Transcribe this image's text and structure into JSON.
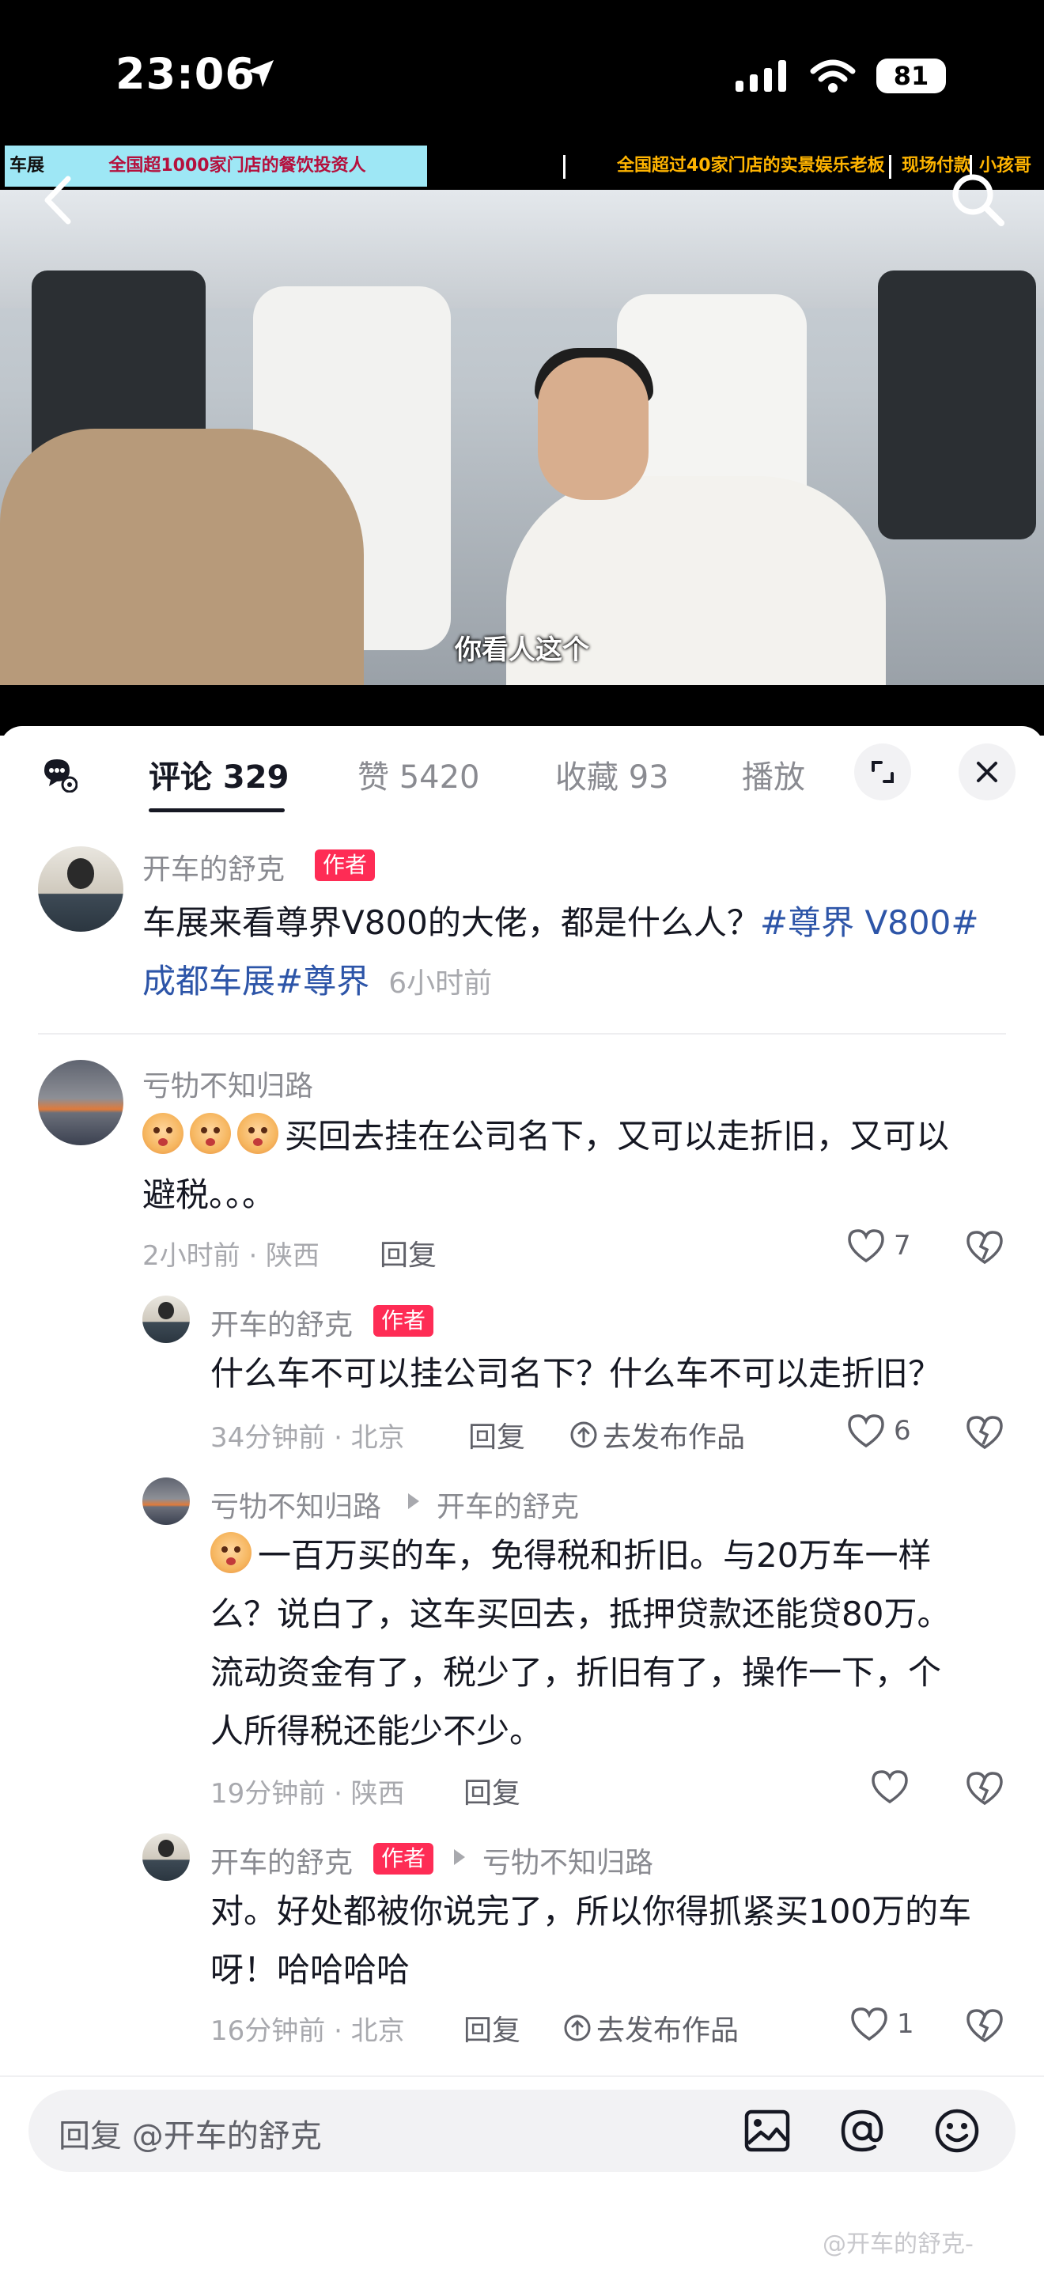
{
  "status_bar": {
    "time": "23:06",
    "battery": "81"
  },
  "video": {
    "banner_left": "车展",
    "banner_cyan": "全国超1000家门店的餐饮投资人",
    "banner_mid": "全国超过40家门店的实景娱乐老板",
    "banner_pay": "现场付款",
    "banner_kid": "小孩哥",
    "subtitle": "你看人这个"
  },
  "tabs": {
    "comments": "评论 329",
    "likes": "赞 5420",
    "favorites": "收藏 93",
    "play": "播放"
  },
  "post": {
    "author": "开车的舒克",
    "badge": "作者",
    "text_line1_plain": "车展来看尊界V800的大佬，都是什么人？",
    "text_line1_tag": "#尊界 V800#",
    "text_line2_tag": "成都车展#尊界",
    "time": "6小时前"
  },
  "comments": [
    {
      "user": "亏牞不知归路",
      "text_line1": "买回去挂在公司名下，又可以走折旧，又可以",
      "text_line2": "避税。。。",
      "meta": "2小时前 · 陕西",
      "reply": "回复",
      "likes": "7"
    },
    {
      "user": "开车的舒克",
      "badge": "作者",
      "text": "什么车不可以挂公司名下？什么车不可以走折旧？",
      "meta": "34分钟前 · 北京",
      "reply": "回复",
      "publish": "去发布作品",
      "likes": "6"
    },
    {
      "user": "亏牞不知归路",
      "reply_to": "开车的舒克",
      "text_line1": "一百万买的车，免得税和折旧。与20万车一样",
      "text_line2": "么？说白了，这车买回去，抵押贷款还能贷80万。",
      "text_line3": "流动资金有了，税少了，折旧有了，操作一下，个",
      "text_line4": "人所得税还能少不少。",
      "meta": "19分钟前 · 陕西",
      "reply": "回复"
    },
    {
      "user": "开车的舒克",
      "badge": "作者",
      "reply_to": "亏牞不知归路",
      "text_line1": "对。好处都被你说完了，所以你得抓紧买100万的车",
      "text_line2": "呀！哈哈哈哈",
      "meta": "16分钟前 · 北京",
      "reply": "回复",
      "publish": "去发布作品",
      "likes": "1"
    }
  ],
  "input": {
    "placeholder": "回复 @开车的舒克"
  },
  "watermark": "@开车的舒克-"
}
